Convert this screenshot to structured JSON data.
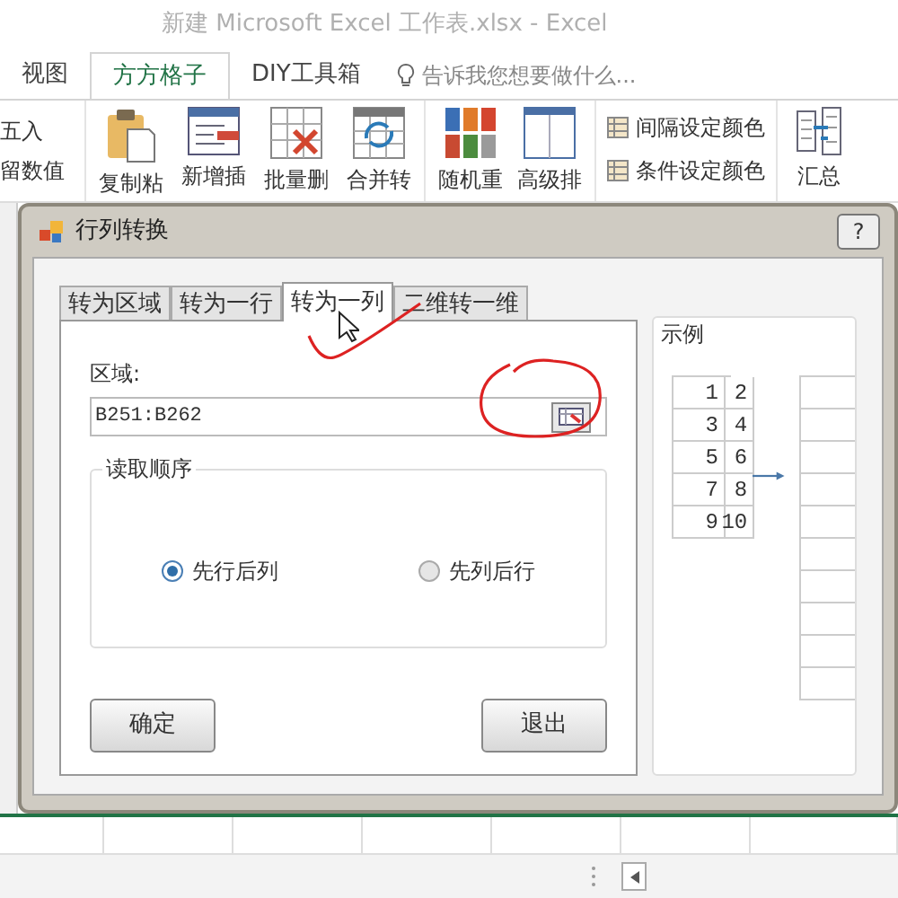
{
  "window": {
    "title": "新建 Microsoft Excel 工作表.xlsx - Excel"
  },
  "ribbon_tabs": [
    {
      "label": "视图",
      "selected": false
    },
    {
      "label": "方方格子",
      "selected": true
    },
    {
      "label": "DIY工具箱",
      "selected": false
    }
  ],
  "tell_me": {
    "placeholder": "告诉我您想要做什么..."
  },
  "ribbon_left": [
    "五入",
    "留数值"
  ],
  "ribbon_buttons": [
    "复制粘",
    "新增插",
    "批量删",
    "合并转",
    "随机重",
    "高级排"
  ],
  "ribbon_small": [
    "间隔设定颜色",
    "条件设定颜色"
  ],
  "summary_button": "汇总",
  "dialog": {
    "title": "行列转换",
    "help": "?",
    "tabs": [
      {
        "label": "转为区域",
        "selected": false
      },
      {
        "label": "转为一行",
        "selected": false
      },
      {
        "label": "转为一列",
        "selected": true
      },
      {
        "label": "二维转一维",
        "selected": false
      }
    ],
    "range_label": "区域:",
    "range_value": "B251:B262",
    "order_group": "读取顺序",
    "order_options": [
      {
        "label": "先行后列",
        "selected": true
      },
      {
        "label": "先列后行",
        "selected": false
      }
    ],
    "buttons": [
      "确定",
      "退出"
    ],
    "example": {
      "title": "示例",
      "grid": [
        [
          "1",
          "2"
        ],
        [
          "3",
          "4"
        ],
        [
          "5",
          "6"
        ],
        [
          "7",
          "8"
        ],
        [
          "9",
          "10"
        ]
      ]
    }
  }
}
